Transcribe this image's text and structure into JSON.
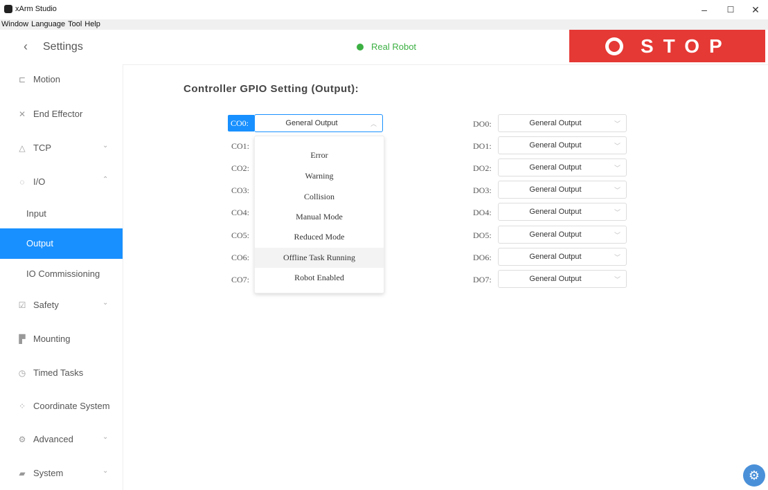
{
  "window": {
    "title": "xArm Studio",
    "minimize": "–",
    "maximize": "☐",
    "close": "✕"
  },
  "menu": [
    "Window",
    "Language",
    "Tool",
    "Help"
  ],
  "header": {
    "back_symbol": "‹",
    "title": "Settings",
    "robot_status": "Real Robot",
    "stop_label": "STOP"
  },
  "sidebar": {
    "items": [
      {
        "label": "Motion",
        "icon": "motion-icon"
      },
      {
        "label": "End Effector",
        "icon": "end-effector-icon"
      },
      {
        "label": "TCP",
        "icon": "tcp-icon",
        "chevron": "⌄"
      },
      {
        "label": "I/O",
        "icon": "io-icon",
        "chevron": "⌃"
      },
      {
        "label": "Input"
      },
      {
        "label": "Output"
      },
      {
        "label": "IO Commissioning"
      },
      {
        "label": "Safety",
        "icon": "safety-icon",
        "chevron": "⌄"
      },
      {
        "label": "Mounting",
        "icon": "mounting-icon"
      },
      {
        "label": "Timed Tasks",
        "icon": "timed-tasks-icon"
      },
      {
        "label": "Coordinate System",
        "icon": "coordinate-system-icon"
      },
      {
        "label": "Advanced",
        "icon": "advanced-icon",
        "chevron": "⌄"
      },
      {
        "label": "System",
        "icon": "system-icon",
        "chevron": "⌄"
      }
    ]
  },
  "main": {
    "title": "Controller GPIO Setting (Output):",
    "co": [
      {
        "label": "CO0:",
        "value": "General Output"
      },
      {
        "label": "CO1:"
      },
      {
        "label": "CO2:"
      },
      {
        "label": "CO3:"
      },
      {
        "label": "CO4:"
      },
      {
        "label": "CO5:"
      },
      {
        "label": "CO6:"
      },
      {
        "label": "CO7:"
      }
    ],
    "do": [
      {
        "label": "DO0:",
        "value": "General Output"
      },
      {
        "label": "DO1:",
        "value": "General Output"
      },
      {
        "label": "DO2:",
        "value": "General Output"
      },
      {
        "label": "DO3:",
        "value": "General Output"
      },
      {
        "label": "DO4:",
        "value": "General Output"
      },
      {
        "label": "DO5:",
        "value": "General Output"
      },
      {
        "label": "DO6:",
        "value": "General Output"
      },
      {
        "label": "DO7:",
        "value": "General Output"
      }
    ],
    "dropdown_options": [
      "Error",
      "Warning",
      "Collision",
      "Manual Mode",
      "Reduced Mode",
      "Offline Task Running",
      "Robot Enabled"
    ]
  },
  "colors": {
    "accent": "#1890ff",
    "stop": "#e53935",
    "status_ok": "#3cb043"
  }
}
